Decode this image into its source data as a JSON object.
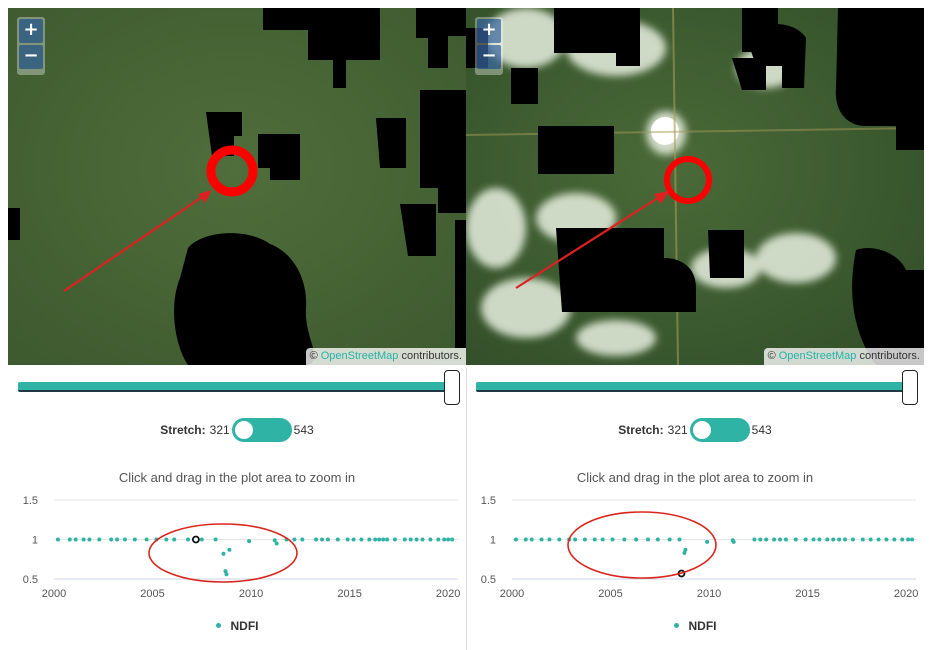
{
  "panels": [
    {
      "id": "left",
      "zoom": {
        "plus": "+",
        "minus": "−"
      },
      "attribution": {
        "prefix": "© ",
        "link": "OpenStreetMap",
        "suffix": " contributors."
      },
      "stretch": {
        "label": "Stretch:",
        "min": "321",
        "max": "543"
      },
      "plot": {
        "hint": "Click and drag in the plot area to zoom in",
        "legend": "NDFI",
        "chart_data": {
          "type": "scatter",
          "series": [
            {
              "name": "NDFI",
              "color": "#2fb3a4",
              "x": [
                2000.2,
                2000.8,
                2001.1,
                2001.5,
                2001.8,
                2002.3,
                2002.9,
                2003.2,
                2003.6,
                2004.1,
                2004.7,
                2005.2,
                2005.7,
                2006.1,
                2006.8,
                2007.1,
                2007.5,
                2008.2,
                2008.6,
                2008.7,
                2008.75,
                2008.9,
                2009.9,
                2011.2,
                2011.3,
                2011.8,
                2012.2,
                2012.6,
                2013.3,
                2013.6,
                2013.9,
                2014.4,
                2014.9,
                2015.2,
                2015.6,
                2016.0,
                2016.3,
                2016.5,
                2016.7,
                2016.9,
                2017.3,
                2017.8,
                2018.1,
                2018.4,
                2018.7,
                2019.1,
                2019.5,
                2019.8,
                2020.0,
                2020.2
              ],
              "y": [
                1,
                1,
                1,
                1,
                1,
                1,
                1,
                1,
                1,
                1,
                1,
                1,
                1,
                1,
                1,
                1,
                1,
                1,
                0.82,
                0.6,
                0.56,
                0.87,
                0.98,
                0.99,
                0.95,
                1,
                1,
                1,
                1,
                1,
                1,
                1,
                1,
                1,
                1,
                1,
                1,
                1,
                1,
                1,
                1,
                1,
                1,
                1,
                1,
                1,
                1,
                1,
                1,
                1
              ]
            }
          ],
          "highlight": {
            "x": 2007.2,
            "y": 1
          },
          "xticks": [
            "2000",
            "2005",
            "2010",
            "2015",
            "2020"
          ],
          "yticks": [
            "0.5",
            "1",
            "1.5"
          ],
          "xlim": [
            2000,
            2020.5
          ],
          "ylim": [
            0.5,
            1.5
          ],
          "annotation": "red ellipse"
        }
      }
    },
    {
      "id": "right",
      "zoom": {
        "plus": "+",
        "minus": "−"
      },
      "attribution": {
        "prefix": "© ",
        "link": "OpenStreetMap",
        "suffix": " contributors."
      },
      "stretch": {
        "label": "Stretch:",
        "min": "321",
        "max": "543"
      },
      "plot": {
        "hint": "Click and drag in the plot area to zoom in",
        "legend": "NDFI",
        "chart_data": {
          "type": "scatter",
          "series": [
            {
              "name": "NDFI",
              "color": "#2fb3a4",
              "x": [
                2000.2,
                2000.7,
                2001.0,
                2001.5,
                2001.9,
                2002.4,
                2002.9,
                2003.2,
                2003.7,
                2004.2,
                2004.6,
                2005.1,
                2005.7,
                2006.3,
                2006.9,
                2007.4,
                2008.0,
                2008.5,
                2008.75,
                2008.8,
                2009.9,
                2011.2,
                2011.25,
                2012.3,
                2012.6,
                2012.9,
                2013.3,
                2013.6,
                2013.9,
                2014.4,
                2014.9,
                2015.3,
                2015.6,
                2016.0,
                2016.3,
                2016.6,
                2016.9,
                2017.3,
                2017.8,
                2018.2,
                2018.6,
                2019.0,
                2019.4,
                2019.8,
                2020.1,
                2020.3
              ],
              "y": [
                1,
                1,
                1,
                1,
                1,
                1,
                1,
                1,
                1,
                1,
                1,
                1,
                1,
                1,
                1,
                1,
                1,
                1,
                0.83,
                0.87,
                0.97,
                0.99,
                0.97,
                1,
                1,
                1,
                1,
                1,
                1,
                1,
                1,
                1,
                1,
                1,
                1,
                1,
                1,
                1,
                1,
                1,
                1,
                1,
                1,
                1,
                1,
                1
              ]
            }
          ],
          "highlight": {
            "x": 2008.6,
            "y": 0.57
          },
          "xticks": [
            "2000",
            "2005",
            "2010",
            "2015",
            "2020"
          ],
          "yticks": [
            "0.5",
            "1",
            "1.5"
          ],
          "xlim": [
            2000,
            2020.5
          ],
          "ylim": [
            0.5,
            1.5
          ],
          "annotation": "red ellipse"
        }
      }
    }
  ],
  "colors": {
    "accent": "#2fb3a4",
    "annotation": "#d9261c"
  }
}
